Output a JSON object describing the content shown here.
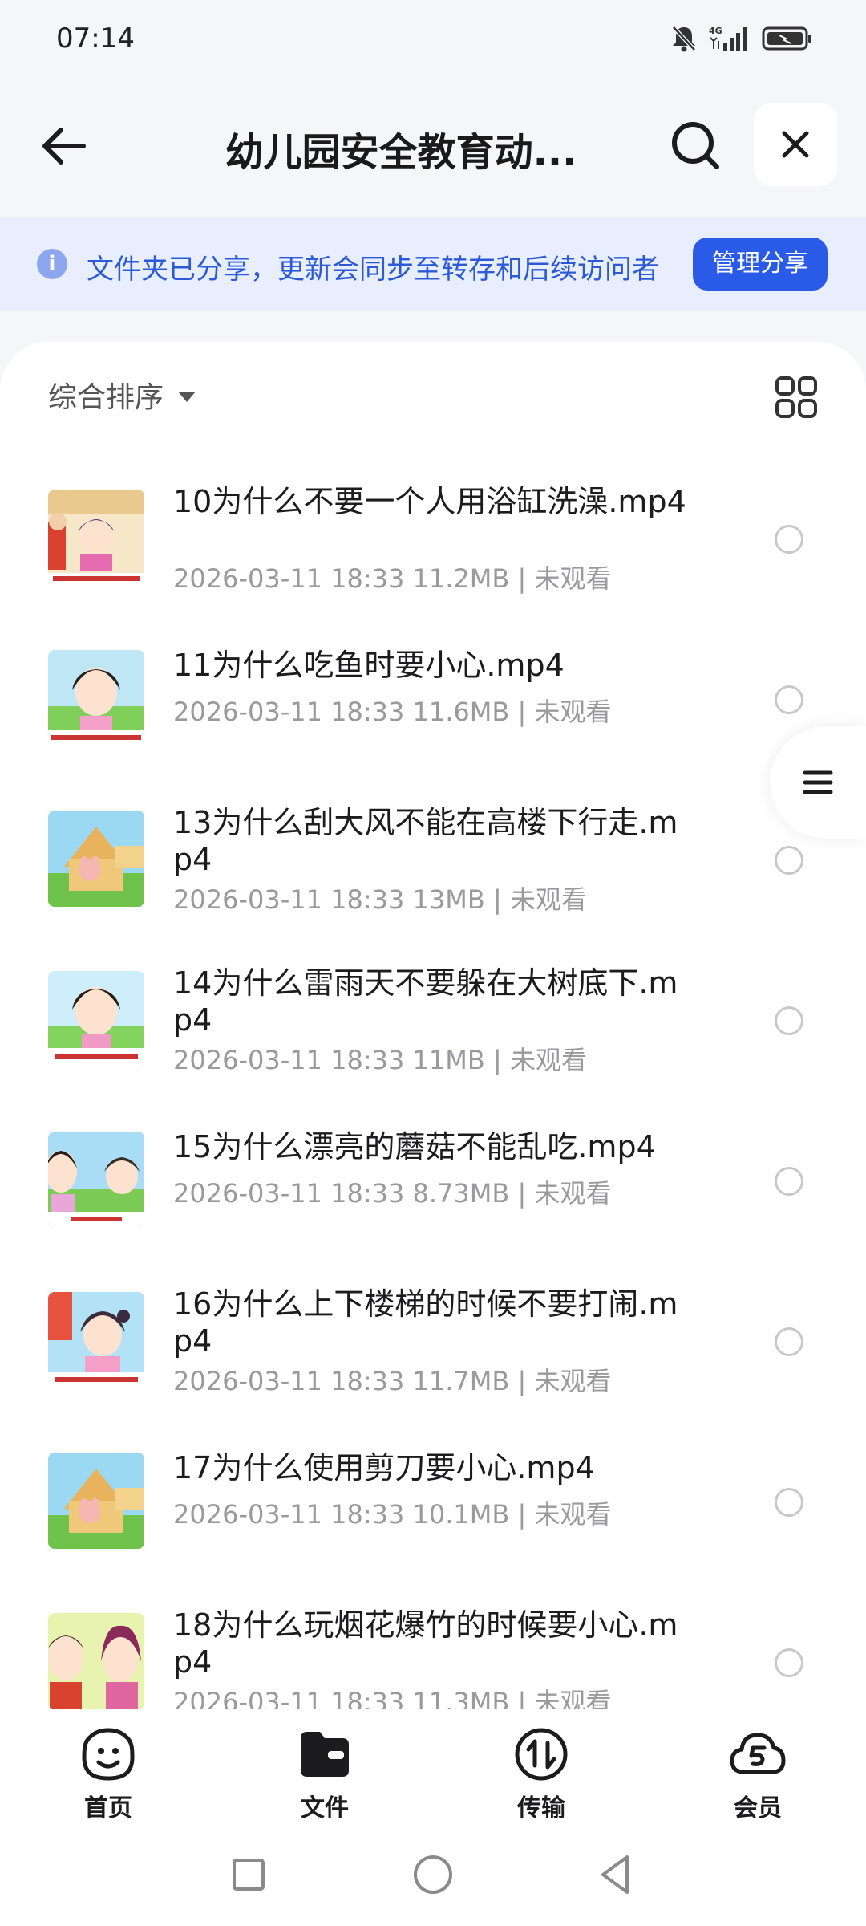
{
  "status_bar": {
    "time": "07:14",
    "network": "4G"
  },
  "header": {
    "title": "幼儿园安全教育动...",
    "back_icon": "arrow-left-icon",
    "search_icon": "search-icon",
    "close_icon": "close-icon"
  },
  "share_banner": {
    "text": "文件夹已分享，更新会同步至转存和后续访问者",
    "button_label": "管理分享",
    "accent": "#2a5ae8"
  },
  "toolbar": {
    "sort_label": "综合排序"
  },
  "files": [
    {
      "name": "10为什么不要一个人用浴缸洗澡.mp4",
      "date": "2026-03-11 18:33",
      "size": "11.2MB",
      "status": "未观看"
    },
    {
      "name": "11为什么吃鱼时要小心.mp4",
      "date": "2026-03-11 18:33",
      "size": "11.6MB",
      "status": "未观看"
    },
    {
      "name": "13为什么刮大风不能在高楼下行走.mp4",
      "date": "2026-03-11 18:33",
      "size": "13MB",
      "status": "未观看"
    },
    {
      "name": "14为什么雷雨天不要躲在大树底下.mp4",
      "date": "2026-03-11 18:33",
      "size": "11MB",
      "status": "未观看"
    },
    {
      "name": "15为什么漂亮的蘑菇不能乱吃.mp4",
      "date": "2026-03-11 18:33",
      "size": "8.73MB",
      "status": "未观看"
    },
    {
      "name": "16为什么上下楼梯的时候不要打闹.mp4",
      "date": "2026-03-11 18:33",
      "size": "11.7MB",
      "status": "未观看"
    },
    {
      "name": "17为什么使用剪刀要小心.mp4",
      "date": "2026-03-11 18:33",
      "size": "10.1MB",
      "status": "未观看"
    },
    {
      "name": "18为什么玩烟花爆竹的时候要小心.mp4",
      "date": "2026-03-11 18:33",
      "size": "11.3MB",
      "status": "未观看"
    }
  ],
  "bottom_nav": [
    {
      "label": "首页",
      "icon": "home-smile-icon"
    },
    {
      "label": "文件",
      "icon": "folder-icon"
    },
    {
      "label": "传输",
      "icon": "transfer-icon"
    },
    {
      "label": "会员",
      "icon": "vip-cloud-icon"
    }
  ]
}
